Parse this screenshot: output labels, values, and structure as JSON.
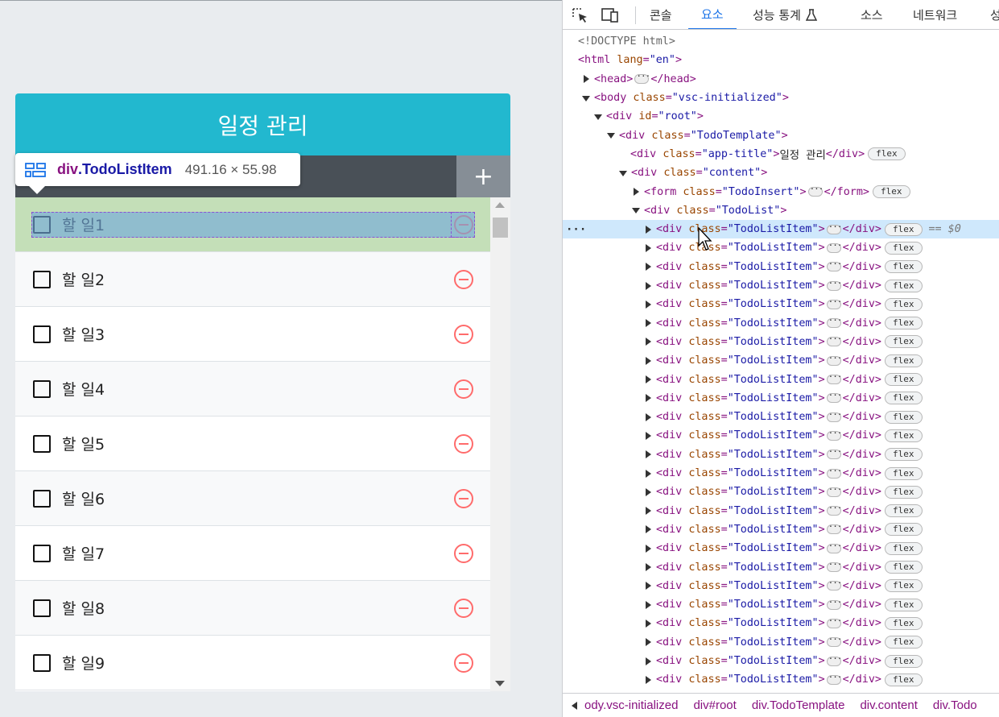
{
  "app": {
    "title": "일정 관리",
    "add_label": "+",
    "items": [
      {
        "text": "할 일1"
      },
      {
        "text": "할 일2"
      },
      {
        "text": "할 일3"
      },
      {
        "text": "할 일4"
      },
      {
        "text": "할 일5"
      },
      {
        "text": "할 일6"
      },
      {
        "text": "할 일7"
      },
      {
        "text": "할 일8"
      },
      {
        "text": "할 일9"
      }
    ]
  },
  "tooltip": {
    "tag": "div",
    "class": ".TodoListItem",
    "size": "491.16 × 55.98"
  },
  "devtools": {
    "tabs": [
      "콘솔",
      "요소",
      "성능 통계",
      "소스",
      "네트워크",
      "성"
    ],
    "active_tab": "요소",
    "tree": {
      "doctype": "<!DOCTYPE html>",
      "html_open": "<html",
      "html_attr": "lang",
      "html_val": "\"en\"",
      "head": "<head>",
      "head_close": "</head>",
      "body_tag": "<body",
      "body_val": "\"vsc-initialized\"",
      "div_tag": "<div",
      "id_attr": "id",
      "root_val": "\"root\"",
      "class_attr": "class",
      "template_val": "\"TodoTemplate\"",
      "apptitle_val": "\"app-title\"",
      "apptitle_text": "일정 관리",
      "div_close": "</div>",
      "content_val": "\"content\"",
      "form_tag": "<form",
      "insert_val": "\"TodoInsert\"",
      "form_close": "</form>",
      "todolist_val": "\"TodoList\"",
      "item_val": "\"TodoListItem\"",
      "badge": "flex",
      "selected_suffix": "== $0",
      "row_gt": ">",
      "item_count": 25
    },
    "breadcrumbs": [
      "ody.vsc-initialized",
      "div#root",
      "div.TodoTemplate",
      "div.content",
      "div.Todo"
    ]
  },
  "colors": {
    "title_bg": "#22b8cf",
    "insert_bg": "#495057",
    "add_btn_bg": "#868e96",
    "remove_icon": "#ff6b6b",
    "active_tab": "#1a73e8",
    "selected_row": "#cfe8fc"
  },
  "icons": {
    "remove": "minus-circle-icon",
    "checkbox": "checkbox-blank-icon",
    "inspect": "inspect-element-icon",
    "device": "device-toolbar-icon",
    "flask": "flask-icon"
  }
}
